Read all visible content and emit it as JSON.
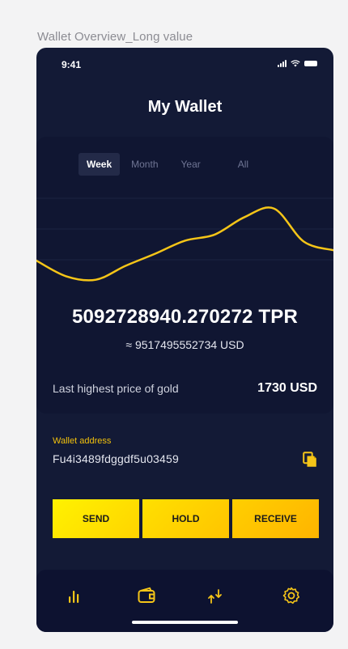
{
  "frame_caption": "Wallet Overview_Long value",
  "status_bar": {
    "time": "9:41"
  },
  "header": {
    "title": "My Wallet"
  },
  "tabs": [
    {
      "label": "Week",
      "active": true
    },
    {
      "label": "Month",
      "active": false
    },
    {
      "label": "Year",
      "active": false
    },
    {
      "label": "All",
      "active": false
    }
  ],
  "chart_data": {
    "type": "line",
    "title": "",
    "xlabel": "",
    "ylabel": "",
    "grid": true,
    "line_color": "#f5c518",
    "x": [
      0,
      1,
      2,
      3,
      4,
      5,
      6,
      7,
      8,
      9,
      10
    ],
    "series": [
      {
        "values": [
          40,
          22,
          18,
          34,
          48,
          63,
          70,
          90,
          100,
          62,
          52
        ]
      }
    ],
    "ylim": [
      0,
      110
    ]
  },
  "balance": {
    "amount": "5092728940.270272 TPR",
    "usd": "≈ 9517495552734 USD"
  },
  "gold": {
    "label": "Last highest price of gold",
    "value": "1730 USD"
  },
  "wallet": {
    "label": "Wallet address",
    "address": "Fu4i3489fdggdf5u03459"
  },
  "actions": {
    "send": "SEND",
    "hold": "HOLD",
    "receive": "RECEIVE"
  },
  "nav": {
    "items": [
      "chart-icon",
      "wallet-icon",
      "transfer-icon",
      "settings-icon"
    ],
    "accent": "#f5c518"
  },
  "colors": {
    "background": "#131a36",
    "card": "#101632",
    "accent": "#f5c518"
  }
}
